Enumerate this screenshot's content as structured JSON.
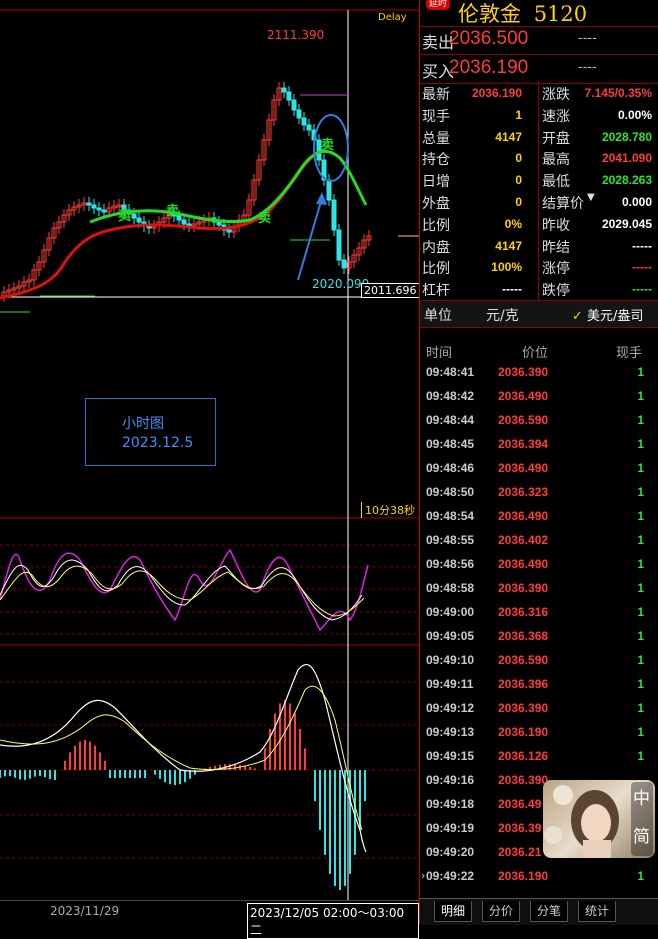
{
  "chart": {
    "delay_label": "Delay",
    "high_label": "2111.390",
    "low_label": "2020.090",
    "price_tag": "2011.696",
    "note_line1": "小时图",
    "note_line2": "2023.12.5",
    "countdown": "10分38秒",
    "signal_label": "卖",
    "signal_label_buy": "卖",
    "colors": {
      "up": "#ff3b3b",
      "down": "#2ee5e5",
      "ma_red": "#e01010",
      "ma_green": "#22dd22",
      "annotation": "#2f7fe0"
    }
  },
  "bottom": {
    "date_left": "2023/11/29",
    "date_range": "2023/12/05 02:00～03:00 二"
  },
  "panel": {
    "badge": "延时",
    "symbol": "伦敦金",
    "code": "5120",
    "ask_label": "卖出",
    "ask": "2036.500",
    "ask_dash": "----",
    "bid_label": "买入",
    "bid": "2036.190",
    "bid_dash": "----",
    "stats_left": [
      {
        "label": "最新",
        "value": "2036.190",
        "color": "red"
      },
      {
        "label": "现手",
        "value": "1",
        "color": "yellow"
      },
      {
        "label": "总量",
        "value": "4147",
        "color": "yellow"
      },
      {
        "label": "持仓",
        "value": "0",
        "color": "yellow"
      },
      {
        "label": "日增",
        "value": "0",
        "color": "yellow"
      },
      {
        "label": "外盘",
        "value": "0",
        "color": "yellow"
      },
      {
        "label": "比例",
        "value": "0%",
        "color": "yellow"
      },
      {
        "label": "内盘",
        "value": "4147",
        "color": "yellow"
      },
      {
        "label": "比例",
        "value": "100%",
        "color": "yellow"
      },
      {
        "label": "杠杆",
        "value": "-----",
        "color": "white"
      }
    ],
    "stats_right": [
      {
        "label": "涨跌",
        "value": "7.145/0.35%",
        "color": "red"
      },
      {
        "label": "速涨",
        "value": "0.00%",
        "color": "white"
      },
      {
        "label": "开盘",
        "value": "2028.780",
        "color": "green"
      },
      {
        "label": "最高",
        "value": "2041.090",
        "color": "red"
      },
      {
        "label": "最低",
        "value": "2028.263",
        "color": "green"
      },
      {
        "label": "结算价",
        "value": "0.000",
        "color": "white"
      },
      {
        "label": "昨收",
        "value": "2029.045",
        "color": "white"
      },
      {
        "label": "昨结",
        "value": "-----",
        "color": "white"
      },
      {
        "label": "涨停",
        "value": "-----",
        "color": "red"
      },
      {
        "label": "跌停",
        "value": "-----",
        "color": "green"
      }
    ],
    "unit_label": "单位",
    "unit_value": "元/克",
    "currency_option": "美元/盎司",
    "tick_headers": {
      "time": "时间",
      "price": "价位",
      "qty": "现手"
    },
    "ticks": [
      {
        "time": "09:48:41",
        "price": "2036.390",
        "qty": "1"
      },
      {
        "time": "09:48:42",
        "price": "2036.490",
        "qty": "1"
      },
      {
        "time": "09:48:44",
        "price": "2036.590",
        "qty": "1"
      },
      {
        "time": "09:48:45",
        "price": "2036.394",
        "qty": "1"
      },
      {
        "time": "09:48:46",
        "price": "2036.490",
        "qty": "1"
      },
      {
        "time": "09:48:50",
        "price": "2036.323",
        "qty": "1"
      },
      {
        "time": "09:48:54",
        "price": "2036.490",
        "qty": "1"
      },
      {
        "time": "09:48:55",
        "price": "2036.402",
        "qty": "1"
      },
      {
        "time": "09:48:56",
        "price": "2036.490",
        "qty": "1"
      },
      {
        "time": "09:48:58",
        "price": "2036.390",
        "qty": "1"
      },
      {
        "time": "09:49:00",
        "price": "2036.316",
        "qty": "1"
      },
      {
        "time": "09:49:05",
        "price": "2036.368",
        "qty": "1"
      },
      {
        "time": "09:49:10",
        "price": "2036.590",
        "qty": "1"
      },
      {
        "time": "09:49:11",
        "price": "2036.396",
        "qty": "1"
      },
      {
        "time": "09:49:12",
        "price": "2036.390",
        "qty": "1"
      },
      {
        "time": "09:49:13",
        "price": "2036.190",
        "qty": "1"
      },
      {
        "time": "09:49:15",
        "price": "2036.126",
        "qty": "1"
      },
      {
        "time": "09:49:16",
        "price": "2036.390",
        "qty": ""
      },
      {
        "time": "09:49:18",
        "price": "2036.49",
        "qty": ""
      },
      {
        "time": "09:49:19",
        "price": "2036.39",
        "qty": ""
      },
      {
        "time": "09:49:20",
        "price": "2036.21",
        "qty": ""
      },
      {
        "time": "09:49:22",
        "price": "2036.190",
        "qty": "1"
      }
    ],
    "tabs": [
      "明细",
      "分价",
      "分笔",
      "统计"
    ],
    "overlay": {
      "line1": "中",
      "line2": "简"
    }
  }
}
